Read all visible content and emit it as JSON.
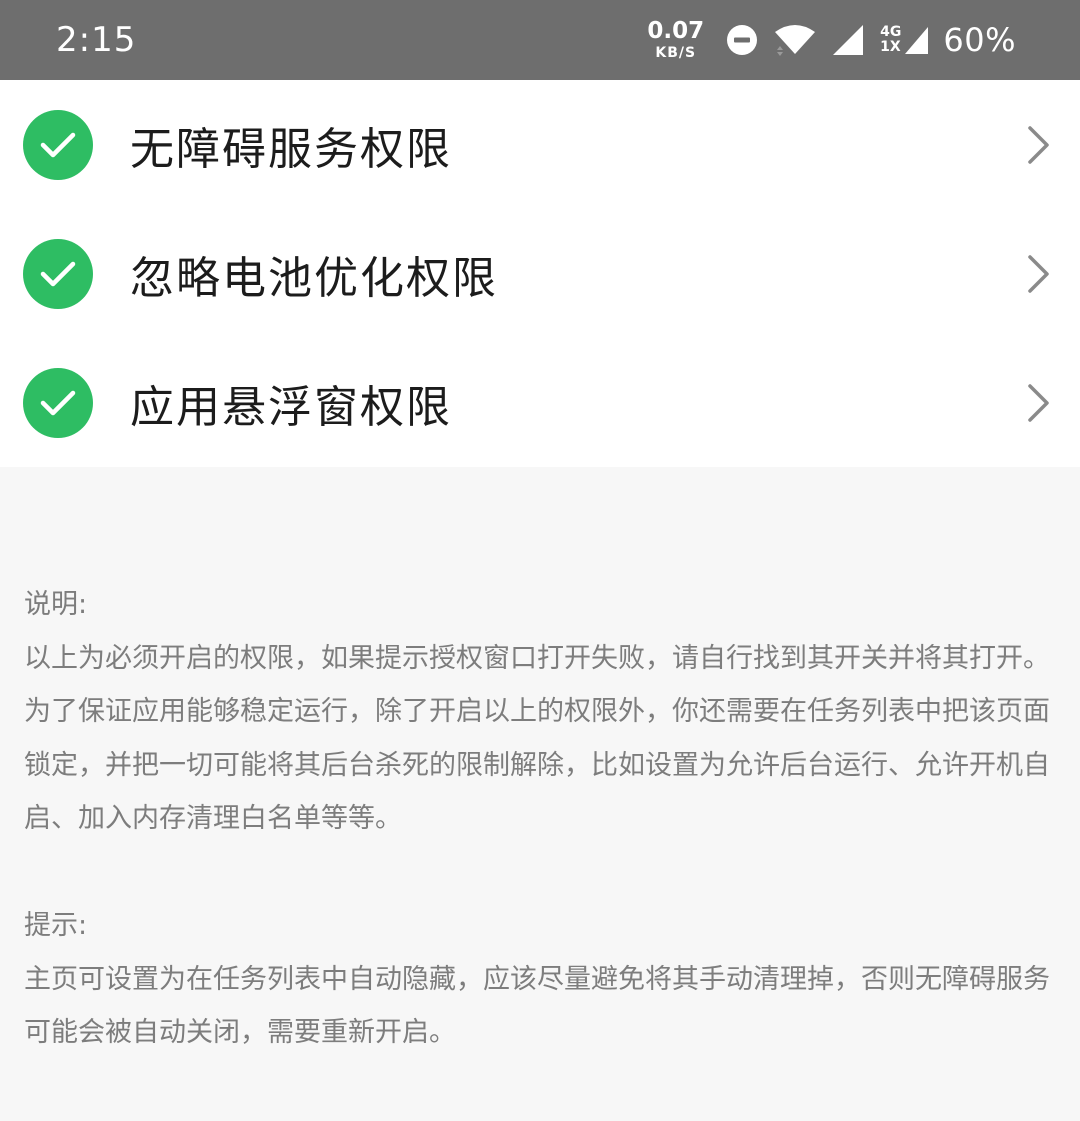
{
  "status_bar": {
    "time": "2:15",
    "net_speed_value": "0.07",
    "net_speed_unit": "KB/S",
    "net_type_top": "4G",
    "net_type_bottom": "1X",
    "battery": "60%",
    "icons": [
      "dnd-icon",
      "wifi-icon",
      "signal-icon",
      "signal-4g-icon"
    ]
  },
  "permissions": [
    {
      "label": "无障碍服务权限",
      "granted": true
    },
    {
      "label": "忽略电池优化权限",
      "granted": true
    },
    {
      "label": "应用悬浮窗权限",
      "granted": true
    }
  ],
  "notes": {
    "explain_title": "说明:",
    "explain_body": "以上为必须开启的权限，如果提示授权窗口打开失败，请自行找到其开关并将其打开。为了保证应用能够稳定运行，除了开启以上的权限外，你还需要在任务列表中把该页面锁定，并把一切可能将其后台杀死的限制解除，比如设置为允许后台运行、允许开机自启、加入内存清理白名单等等。",
    "tip_title": "提示:",
    "tip_body": "主页可设置为在任务列表中自动隐藏，应该尽量避免将其手动清理掉，否则无障碍服务可能会被自动关闭，需要重新开启。"
  },
  "colors": {
    "status_bar_bg": "#6e6e6e",
    "check_green": "#2ebd63",
    "chevron": "#8a8a8a",
    "notes_text": "#7d7d7d",
    "page_bg": "#f7f7f7"
  }
}
